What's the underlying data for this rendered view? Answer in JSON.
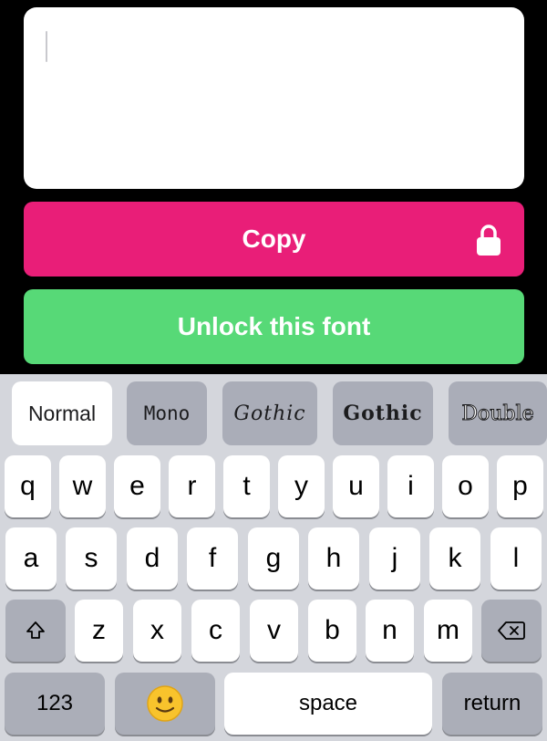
{
  "text_area": {
    "value": ""
  },
  "buttons": {
    "copy_label": "Copy",
    "unlock_label": "Unlock this font"
  },
  "icons": {
    "copy_lock": "lock-icon",
    "shift": "shift-icon",
    "backspace": "backspace-icon",
    "emoji": "smiley-emoji-icon"
  },
  "colors": {
    "copy": "#e91e78",
    "unlock": "#57d977",
    "keyboard_bg": "#d4d6dc",
    "key": "#ffffff",
    "key_dark": "#abaeb8"
  },
  "font_bar": {
    "selected": "Normal",
    "chips": [
      {
        "label": "Normal"
      },
      {
        "label": "Mono"
      },
      {
        "label": "Gothic"
      },
      {
        "label": "Gothic"
      },
      {
        "label": "Double"
      }
    ]
  },
  "keyboard": {
    "row1": [
      "q",
      "w",
      "e",
      "r",
      "t",
      "y",
      "u",
      "i",
      "o",
      "p"
    ],
    "row2": [
      "a",
      "s",
      "d",
      "f",
      "g",
      "h",
      "j",
      "k",
      "l"
    ],
    "row3": [
      "z",
      "x",
      "c",
      "v",
      "b",
      "n",
      "m"
    ],
    "numbers_label": "123",
    "space_label": "space",
    "return_label": "return"
  }
}
